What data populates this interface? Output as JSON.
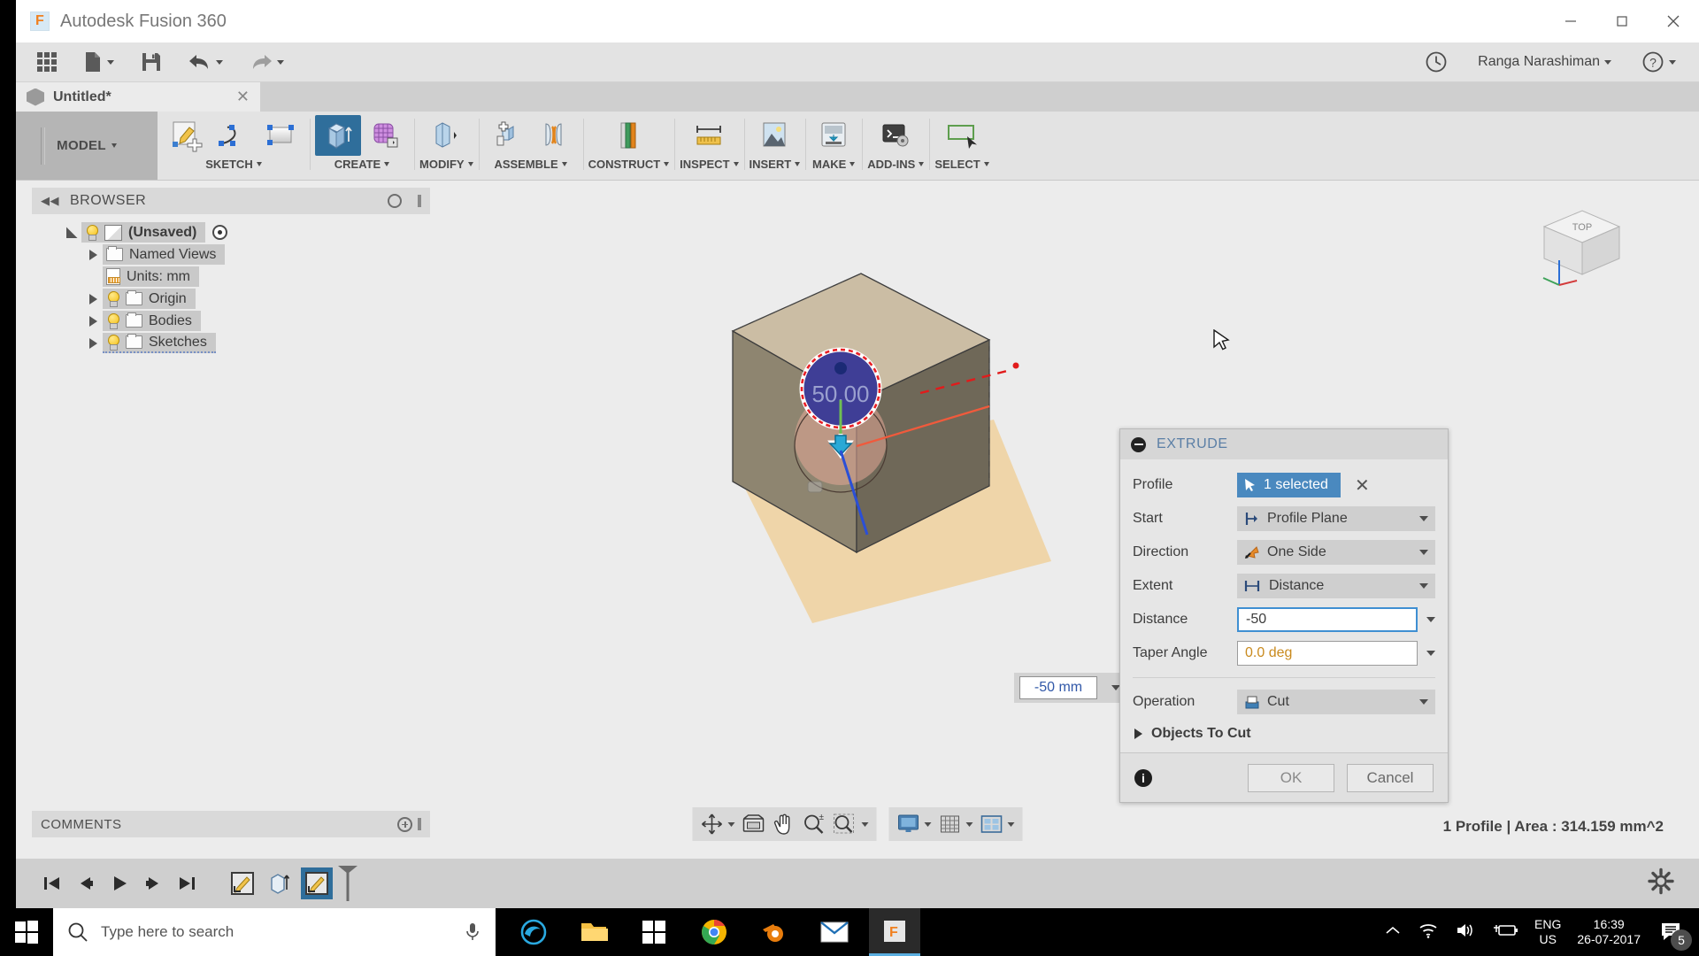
{
  "window": {
    "app_title": "Autodesk Fusion 360",
    "minimize": "–",
    "maximize": "□",
    "close": "✕"
  },
  "quick_access": {
    "apps_grid": "apps-grid-icon",
    "new_label": "new-document",
    "save_label": "save",
    "undo_label": "undo",
    "redo_label": "redo",
    "history_label": "history",
    "user_name": "Ranga Narashiman",
    "help_label": "help"
  },
  "document_tab": {
    "name": "Untitled*",
    "close": "✕"
  },
  "ribbon": {
    "workspace": "MODEL",
    "groups": [
      {
        "label": "SKETCH",
        "icons": [
          "create-sketch-icon",
          "spline-icon",
          "rectangle-icon"
        ]
      },
      {
        "label": "CREATE",
        "icons": [
          "extrude-icon",
          "mesh-icon"
        ]
      },
      {
        "label": "MODIFY",
        "icons": [
          "press-pull-icon"
        ]
      },
      {
        "label": "ASSEMBLE",
        "icons": [
          "new-component-icon",
          "joint-icon"
        ]
      },
      {
        "label": "CONSTRUCT",
        "icons": [
          "offset-plane-icon"
        ]
      },
      {
        "label": "INSPECT",
        "icons": [
          "measure-icon"
        ]
      },
      {
        "label": "INSERT",
        "icons": [
          "insert-image-icon"
        ]
      },
      {
        "label": "MAKE",
        "icons": [
          "3d-print-icon"
        ]
      },
      {
        "label": "ADD-INS",
        "icons": [
          "script-icon"
        ]
      },
      {
        "label": "SELECT",
        "icons": [
          "select-window-icon"
        ]
      }
    ]
  },
  "browser": {
    "title": "BROWSER",
    "collapse_icon": "collapse-left-icon",
    "items": [
      {
        "label": "(Unsaved)",
        "indent": 0,
        "expander": "open",
        "bulb": true,
        "icon": "body-cube-icon",
        "selected": true,
        "radio": true
      },
      {
        "label": "Named Views",
        "indent": 1,
        "expander": "closed",
        "bulb": false,
        "icon": "folder-icon",
        "selected": false,
        "radio": false
      },
      {
        "label": "Units: mm",
        "indent": 1,
        "expander": "none",
        "bulb": false,
        "icon": "units-doc-icon",
        "selected": false,
        "radio": false
      },
      {
        "label": "Origin",
        "indent": 1,
        "expander": "closed",
        "bulb": true,
        "icon": "folder-icon",
        "selected": false,
        "radio": false
      },
      {
        "label": "Bodies",
        "indent": 1,
        "expander": "closed",
        "bulb": true,
        "icon": "folder-icon",
        "selected": false,
        "radio": false
      },
      {
        "label": "Sketches",
        "indent": 1,
        "expander": "closed",
        "bulb": true,
        "icon": "folder-icon",
        "selected": false,
        "radio": false
      }
    ]
  },
  "comments": {
    "title": "COMMENTS",
    "add_icon": "add-comment-icon"
  },
  "viewport": {
    "viewcube_face": "TOP",
    "sketch_dimension": "50.00",
    "canvas_distance_value": "-50 mm",
    "manipulator_arrow": "drag-arrow-icon"
  },
  "extrude_dialog": {
    "title": "EXTRUDE",
    "collapse_icon": "minimize-icon",
    "rows": [
      {
        "label": "Profile",
        "value": "1 selected",
        "type": "selection",
        "icon": "cursor-arrow-icon",
        "clear": "✕"
      },
      {
        "label": "Start",
        "value": "Profile Plane",
        "type": "dropdown",
        "icon": "profile-plane-icon"
      },
      {
        "label": "Direction",
        "value": "One Side",
        "type": "dropdown",
        "icon": "one-side-icon"
      },
      {
        "label": "Extent",
        "value": "Distance",
        "type": "dropdown",
        "icon": "distance-icon"
      },
      {
        "label": "Distance",
        "value": "-50",
        "type": "input",
        "focused": true
      },
      {
        "label": "Taper Angle",
        "value": "0.0 deg",
        "type": "input",
        "focused": false
      }
    ],
    "operation": {
      "label": "Operation",
      "value": "Cut",
      "icon": "cut-operation-icon"
    },
    "objects_to_cut": "Objects To Cut",
    "info_icon": "info-icon",
    "ok_label": "OK",
    "cancel_label": "Cancel"
  },
  "navigation_bar": {
    "group1": [
      "orbit-icon",
      "look-at-icon",
      "pan-icon",
      "zoom-icon",
      "zoom-window-icon"
    ],
    "group2": [
      "display-settings-icon",
      "grid-snap-icon",
      "viewports-icon"
    ]
  },
  "status_bar": {
    "text": "1 Profile | Area : 314.159 mm^2"
  },
  "timeline": {
    "controls": [
      "skip-to-start-icon",
      "step-back-icon",
      "play-icon",
      "step-forward-icon",
      "skip-to-end-icon"
    ],
    "features": [
      "sketch-feature-icon",
      "extrude-feature-icon",
      "sketch-feature-icon"
    ],
    "settings_icon": "timeline-settings-icon"
  },
  "taskbar": {
    "start_icon": "windows-start-icon",
    "search_placeholder": "Type here to search",
    "mic_icon": "microphone-icon",
    "apps": [
      "edge-icon",
      "file-explorer-icon",
      "store-icon",
      "chrome-icon",
      "blender-icon",
      "mail-icon",
      "fusion360-icon"
    ],
    "tray": {
      "chevron": "show-hidden-icons",
      "wifi": "wifi-icon",
      "volume": "volume-icon",
      "battery": "battery-icon",
      "lang_line1": "ENG",
      "lang_line2": "US",
      "time": "16:39",
      "date": "26-07-2017",
      "notification_count": "5"
    }
  },
  "colors": {
    "accent_blue": "#4a89bf",
    "ribbon_active": "#2f6e9b",
    "chrome_bg": "#e3e3e3",
    "panel_bg": "#e6e6e6"
  }
}
